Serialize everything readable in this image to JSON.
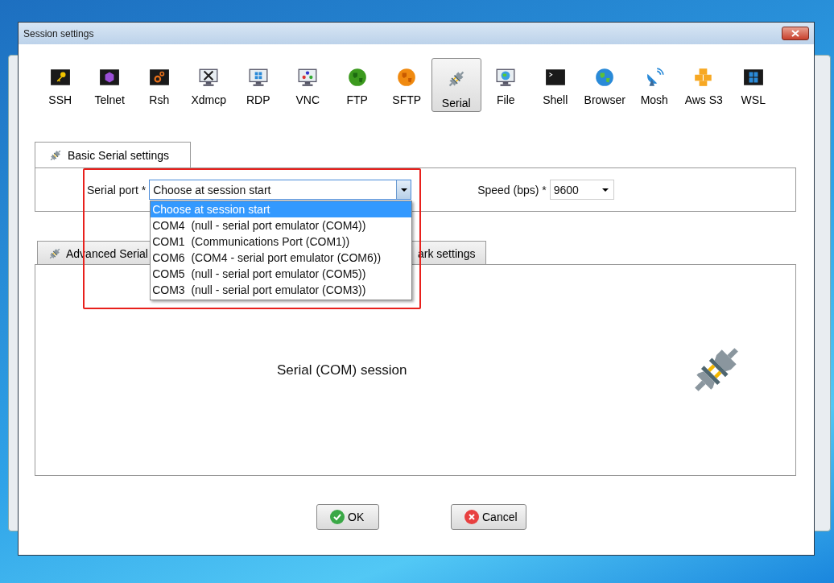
{
  "window": {
    "title": "Session settings"
  },
  "session_types": [
    {
      "label": "SSH",
      "selected": false
    },
    {
      "label": "Telnet",
      "selected": false
    },
    {
      "label": "Rsh",
      "selected": false
    },
    {
      "label": "Xdmcp",
      "selected": false
    },
    {
      "label": "RDP",
      "selected": false
    },
    {
      "label": "VNC",
      "selected": false
    },
    {
      "label": "FTP",
      "selected": false
    },
    {
      "label": "SFTP",
      "selected": false
    },
    {
      "label": "Serial",
      "selected": true
    },
    {
      "label": "File",
      "selected": false
    },
    {
      "label": "Shell",
      "selected": false
    },
    {
      "label": "Browser",
      "selected": false
    },
    {
      "label": "Mosh",
      "selected": false
    },
    {
      "label": "Aws S3",
      "selected": false
    },
    {
      "label": "WSL",
      "selected": false
    }
  ],
  "basic_tab": {
    "label": "Basic Serial settings",
    "selected": true
  },
  "serial_port": {
    "label": "Serial port *",
    "value": "Choose at session start",
    "expanded": true,
    "options": [
      {
        "label": "Choose at session start",
        "selected": true
      },
      {
        "label": "COM4  (null - serial port emulator (COM4))",
        "selected": false
      },
      {
        "label": "COM1  (Communications Port (COM1))",
        "selected": false
      },
      {
        "label": "COM6  (COM4 - serial port emulator (COM6))",
        "selected": false
      },
      {
        "label": "COM5  (null - serial port emulator (COM5))",
        "selected": false
      },
      {
        "label": "COM3  (null - serial port emulator (COM3))",
        "selected": false
      }
    ]
  },
  "speed": {
    "label": "Speed (bps) *",
    "value": "9600"
  },
  "lower_tabs": [
    {
      "label": "Advanced Serial",
      "kind": "icon",
      "selected": false
    },
    {
      "label": "ark settings",
      "kind": "plain",
      "selected": false
    }
  ],
  "panel": {
    "caption": "Serial (COM) session"
  },
  "buttons": [
    {
      "label": "OK",
      "kind": "ok"
    },
    {
      "label": "Cancel",
      "kind": "cancel"
    }
  ],
  "annotation": {
    "kind": "highlight"
  }
}
